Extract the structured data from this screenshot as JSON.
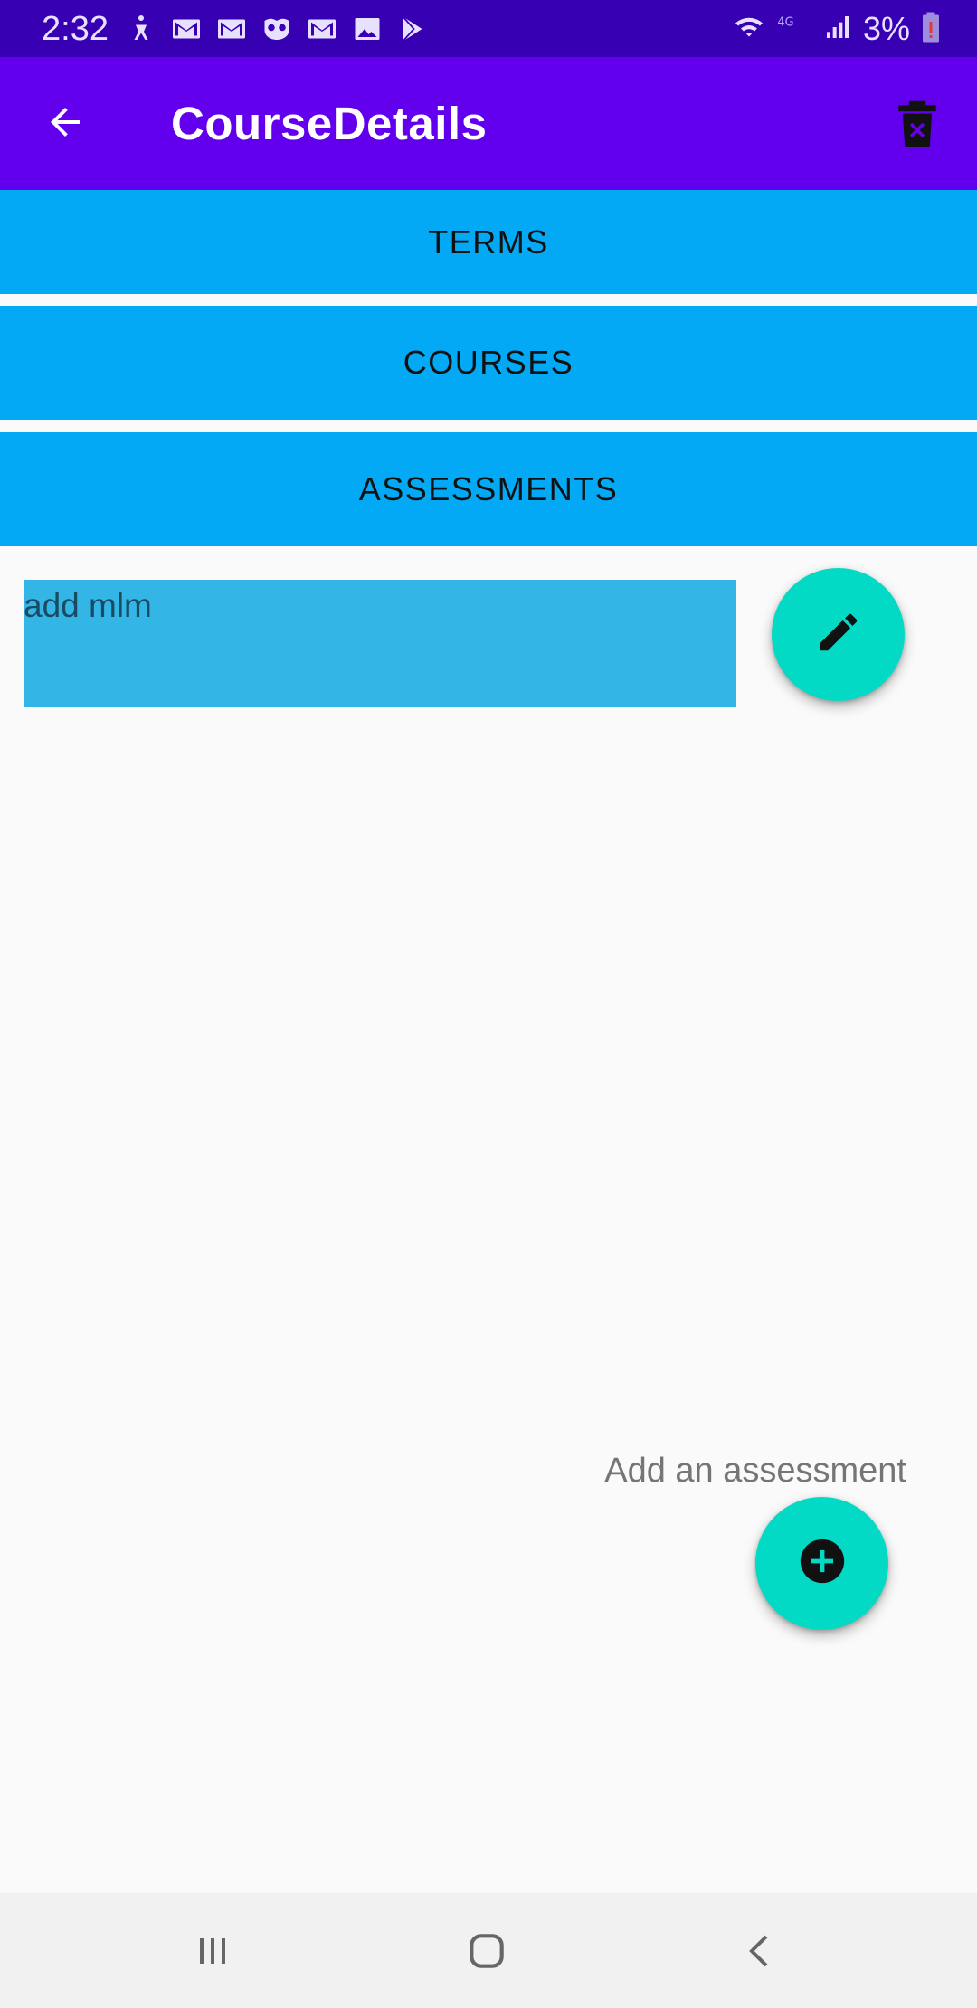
{
  "status_bar": {
    "time": "2:32",
    "battery_percent": "3%",
    "notification_icons": [
      "accessibility-icon",
      "gmail-icon",
      "gmail-icon",
      "owl-icon",
      "gmail-icon",
      "gallery-icon",
      "play-store-icon"
    ]
  },
  "app_bar": {
    "title": "CourseDetails",
    "back_icon": "arrow-back-icon",
    "delete_icon": "delete-icon"
  },
  "nav_buttons": {
    "terms": "TERMS",
    "courses": "COURSES",
    "assessments": "ASSESSMENTS"
  },
  "assessment_list": [
    {
      "title": "add mlm"
    }
  ],
  "add_assessment_label": "Add an assessment",
  "colors": {
    "status_bar": "#3700b3",
    "app_bar": "#6200ee",
    "nav_button": "#03a9f4",
    "list_item": "#33b5e5",
    "fab": "#03dac5"
  }
}
